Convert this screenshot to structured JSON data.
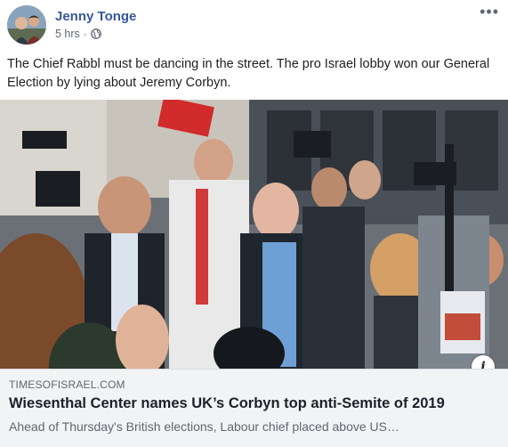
{
  "post": {
    "author": "Jenny Tonge",
    "timestamp": "5 hrs",
    "separator": "·",
    "privacy_icon": "globe-icon",
    "more_label": "•••",
    "text": "The Chief Rabbl must be dancing in the street. The pro Israel lobby won our General Election by lying about Jeremy Corbyn."
  },
  "link_preview": {
    "domain": "TIMESOFISRAEL.COM",
    "title": "Wiesenthal Center names UK’s Corbyn top anti-Semite of 2019",
    "description": "Ahead of Thursday's British elections, Labour chief placed above US…",
    "info_label": "i"
  },
  "colors": {
    "author_link": "#385898",
    "secondary_text": "#606770",
    "preview_bg": "#f2f3f5"
  }
}
